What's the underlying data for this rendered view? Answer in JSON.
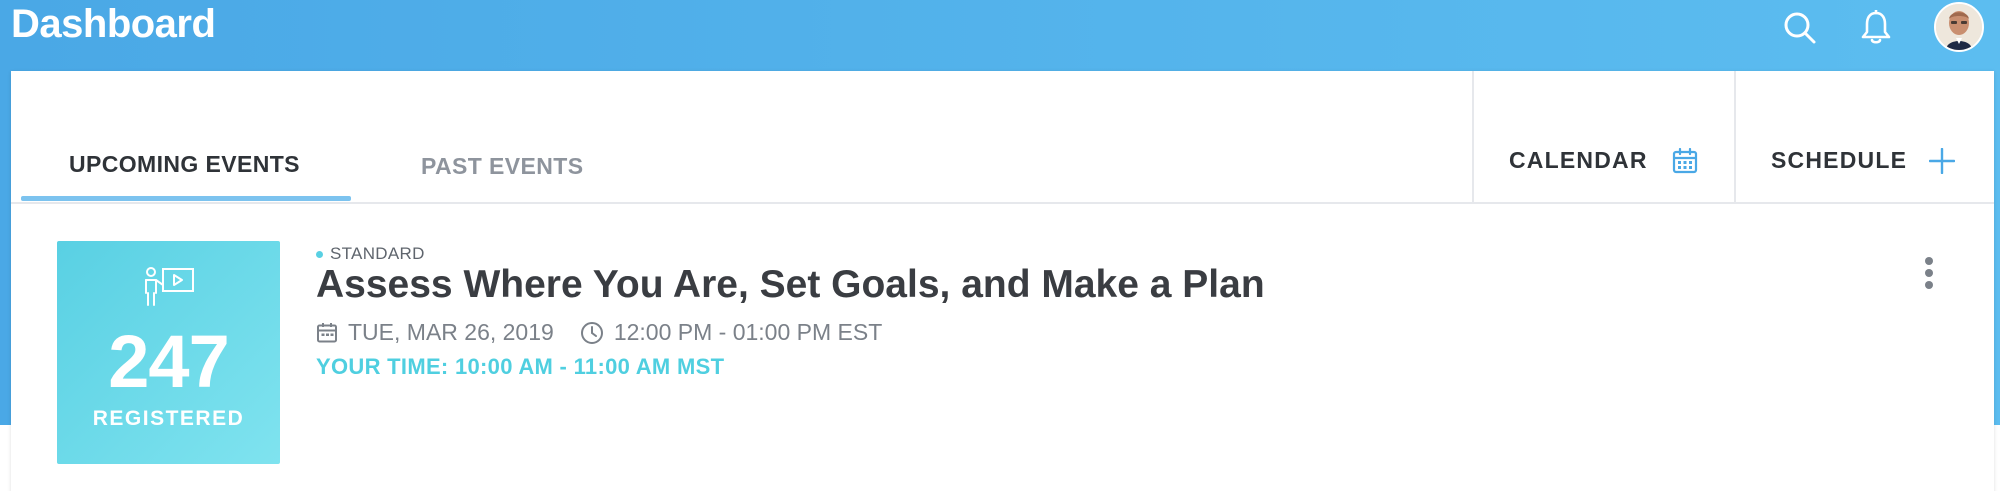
{
  "header": {
    "title": "Dashboard",
    "icons": [
      "search-icon",
      "bell-icon"
    ],
    "avatar_icon": "user-avatar"
  },
  "tabs": {
    "active": "UPCOMING EVENTS",
    "inactive": "PAST EVENTS"
  },
  "actions": {
    "calendar_label": "CALENDAR",
    "calendar_icon": "calendar-icon",
    "schedule_label": "SCHEDULE",
    "schedule_icon": "plus-icon"
  },
  "event": {
    "registered_count": "247",
    "registered_label": "REGISTERED",
    "registered_icon": "presenter-icon",
    "type": "STANDARD",
    "title": "Assess Where You Are, Set Goals, and Make a Plan",
    "date": "TUE, MAR 26, 2019",
    "time": "12:00 PM - 01:00 PM EST",
    "your_time": "YOUR TIME: 10:00 AM - 11:00 AM MST"
  },
  "colors": {
    "header_bg": "#4aa8e6",
    "accent_teal": "#59d0e3",
    "tab_underline": "#7cc3ef",
    "text_dark": "#2f3338"
  }
}
